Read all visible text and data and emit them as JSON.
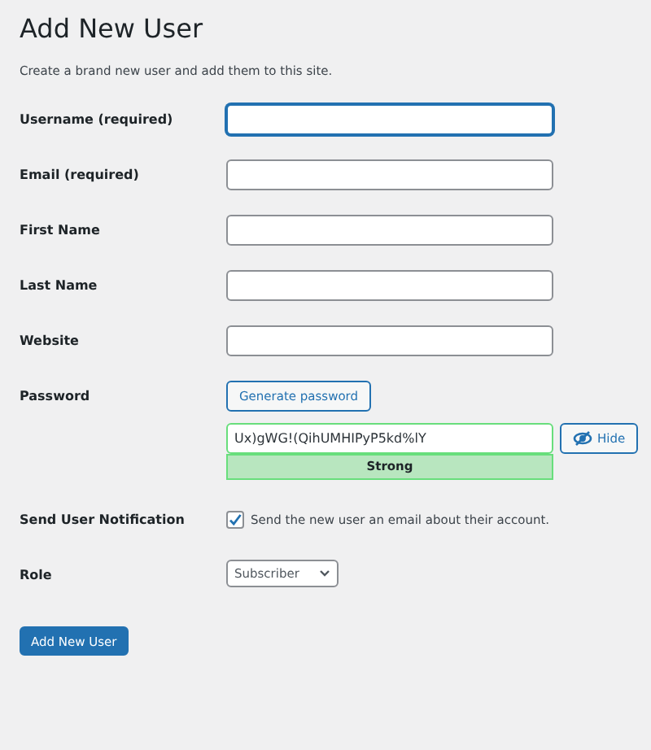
{
  "title": "Add New User",
  "intro": "Create a brand new user and add them to this site.",
  "fields": [
    {
      "kind": "text",
      "label": "Username (required)",
      "focused": true
    },
    {
      "kind": "text",
      "label": "Email (required)",
      "focused": false
    },
    {
      "kind": "text",
      "label": "First Name",
      "focused": false
    },
    {
      "kind": "text",
      "label": "Last Name",
      "focused": false
    },
    {
      "kind": "text",
      "label": "Website",
      "focused": false
    },
    {
      "kind": "password",
      "label": "Password",
      "generate_button": "Generate password",
      "value": "Ux)gWG!(QihUMHIPyP5kd%lY",
      "toggle_button": "Hide",
      "strength": "Strong",
      "strong": true
    },
    {
      "kind": "checkbox",
      "label": "Send User Notification",
      "checked": true,
      "text": "Send the new user an email about their account."
    },
    {
      "kind": "select",
      "label": "Role",
      "value": "Subscriber"
    }
  ],
  "submit": "Add New User"
}
